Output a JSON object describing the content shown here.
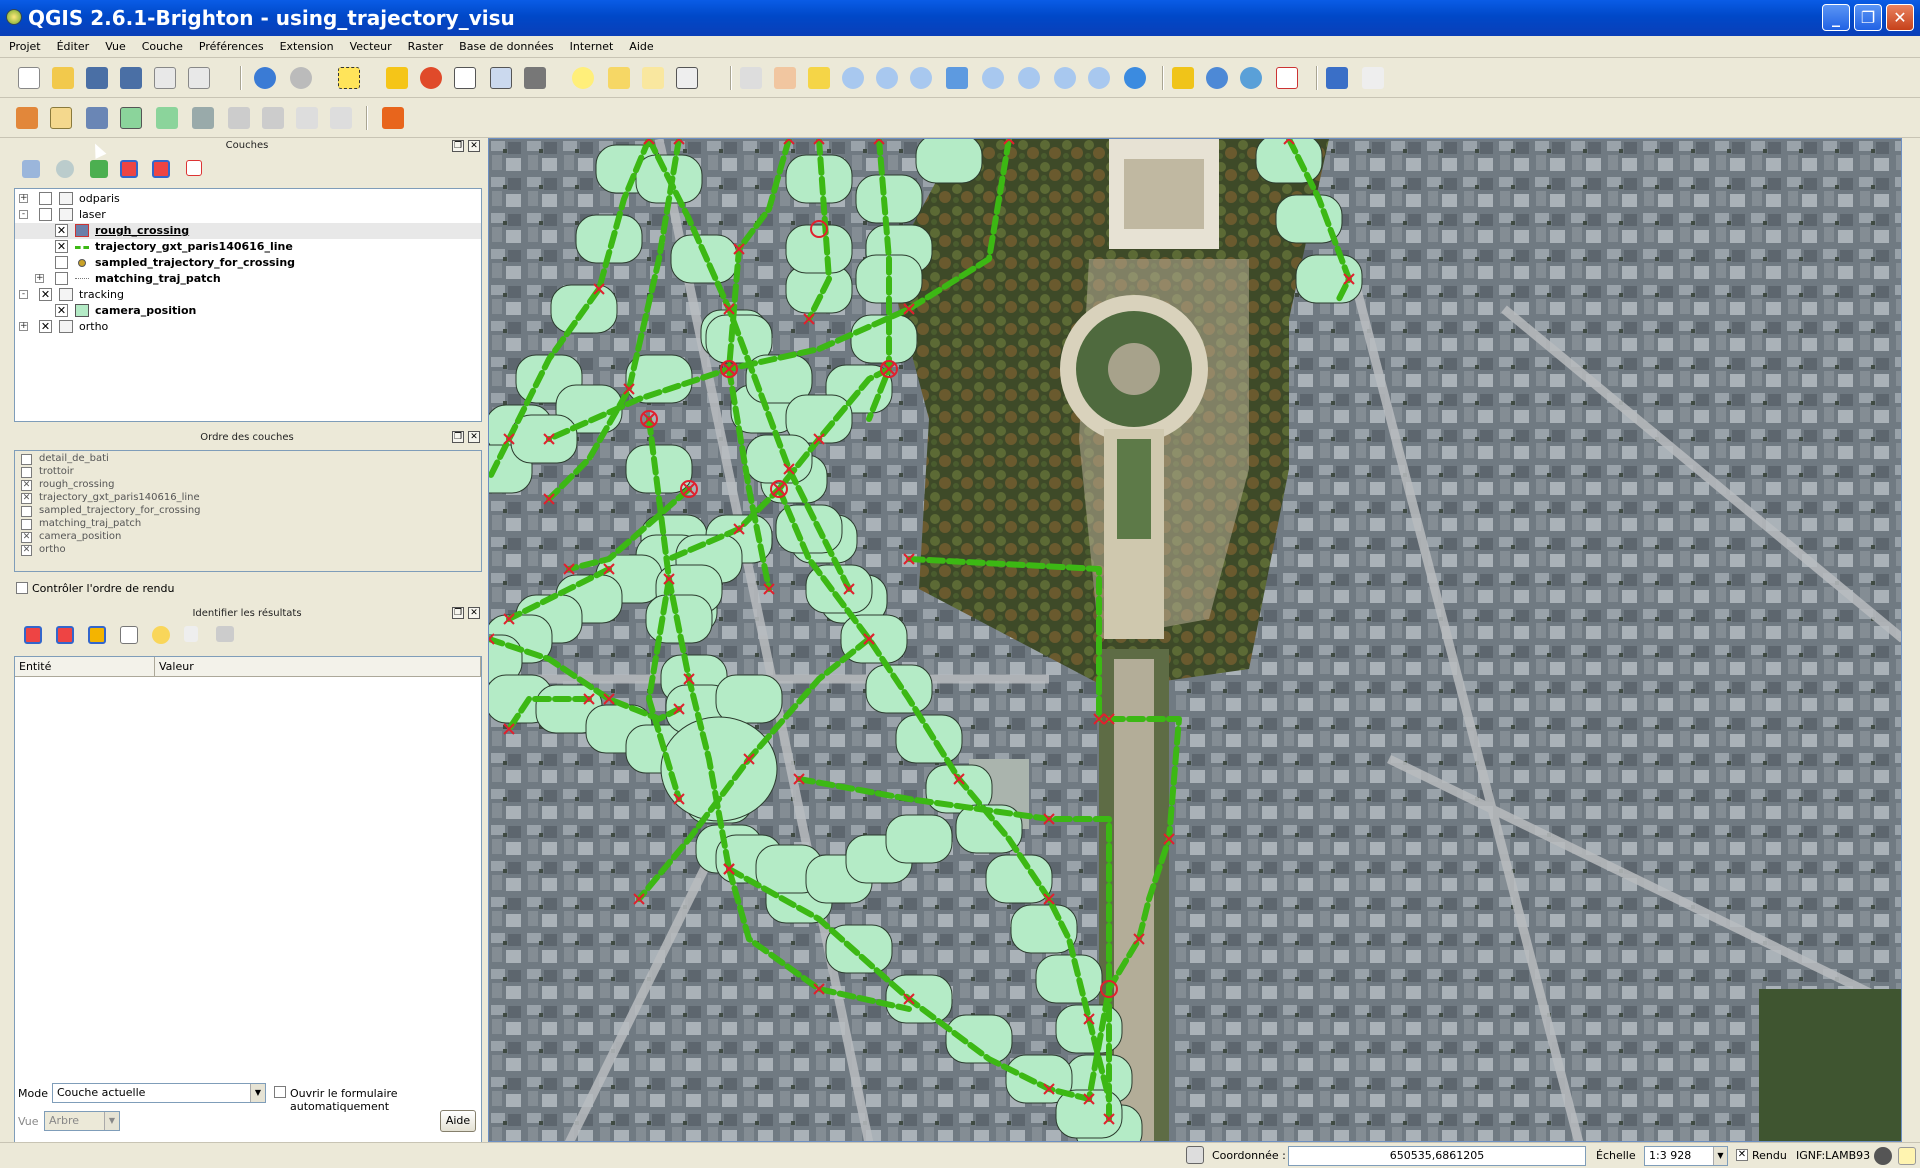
{
  "window": {
    "title": "QGIS 2.6.1-Brighton - using_trajectory_visu"
  },
  "menu": [
    "Projet",
    "Éditer",
    "Vue",
    "Couche",
    "Préférences",
    "Extension",
    "Vecteur",
    "Raster",
    "Base de données",
    "Internet",
    "Aide"
  ],
  "layers_panel": {
    "title": "Couches",
    "items": [
      {
        "label": "odparis",
        "checked": false,
        "group": true,
        "indent": 0,
        "bold": false,
        "expander": "+"
      },
      {
        "label": "laser",
        "checked": false,
        "group": true,
        "indent": 0,
        "bold": false,
        "expander": "-"
      },
      {
        "label": "rough_crossing",
        "checked": true,
        "group": false,
        "indent": 1,
        "bold": true,
        "underline": true,
        "icon": "polygon-layer-icon"
      },
      {
        "label": "trajectory_gxt_paris140616_line",
        "checked": true,
        "group": false,
        "indent": 1,
        "bold": true,
        "icon": "line-layer-icon"
      },
      {
        "label": "sampled_trajectory_for_crossing",
        "checked": false,
        "group": false,
        "indent": 1,
        "bold": true,
        "icon": "point-layer-icon"
      },
      {
        "label": "matching_traj_patch",
        "checked": false,
        "group": false,
        "indent": 1,
        "bold": true,
        "icon": "patch-layer-icon",
        "expander": "+"
      },
      {
        "label": "tracking",
        "checked": true,
        "group": true,
        "indent": 0,
        "bold": false,
        "expander": "-"
      },
      {
        "label": "camera_position",
        "checked": true,
        "group": false,
        "indent": 1,
        "bold": true,
        "icon": "camera-position-icon"
      },
      {
        "label": "ortho",
        "checked": true,
        "group": true,
        "indent": 0,
        "bold": false,
        "expander": "+"
      }
    ]
  },
  "order_panel": {
    "title": "Ordre des couches",
    "items": [
      {
        "label": "detail_de_bati",
        "checked": false
      },
      {
        "label": "trottoir",
        "checked": false
      },
      {
        "label": "rough_crossing",
        "checked": true
      },
      {
        "label": "trajectory_gxt_paris140616_line",
        "checked": true
      },
      {
        "label": "sampled_trajectory_for_crossing",
        "checked": false
      },
      {
        "label": "matching_traj_patch",
        "checked": false
      },
      {
        "label": "camera_position",
        "checked": true
      },
      {
        "label": "ortho",
        "checked": true
      }
    ],
    "control_order_label": "Contrôler l'ordre de rendu"
  },
  "identify_panel": {
    "title": "Identifier les résultats",
    "col_entity": "Entité",
    "col_value": "Valeur",
    "mode_label": "Mode",
    "mode_value": "Couche actuelle",
    "auto_open_label": "Ouvrir le formulaire automatiquement",
    "view_label": "Vue",
    "view_value": "Arbre",
    "help_label": "Aide"
  },
  "statusbar": {
    "coord_label": "Coordonnée :",
    "coord_value": "650535,6861205",
    "scale_label": "Échelle",
    "scale_value": "1:3 928",
    "render_label": "Rendu",
    "crs_label": "IGNF:LAMB93"
  },
  "map": {
    "buffer_color": "#b4ebc6",
    "trajectory_color": "#3cb814",
    "crossing_color": "#e0202e"
  }
}
